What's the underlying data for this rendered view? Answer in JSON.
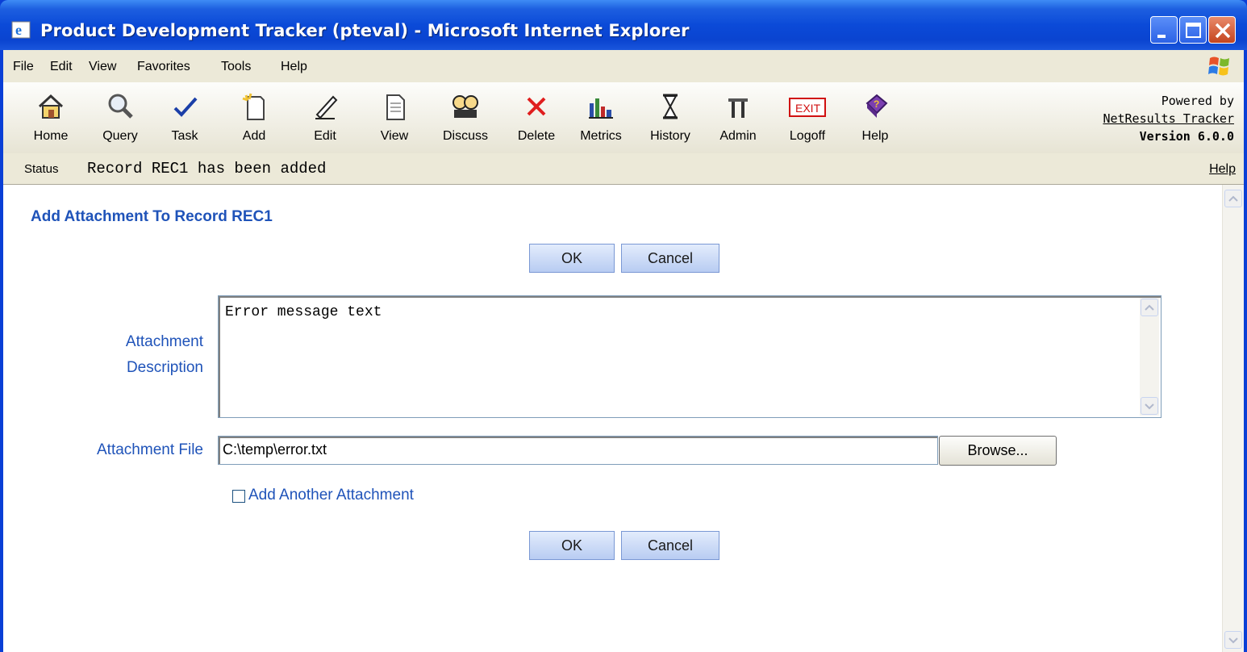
{
  "window": {
    "title": "Product Development Tracker (pteval) - Microsoft Internet Explorer"
  },
  "menu": {
    "items": [
      "File",
      "Edit",
      "View",
      "Favorites",
      "Tools",
      "Help"
    ]
  },
  "toolbar": {
    "buttons": [
      {
        "label": "Home",
        "icon": "home-icon"
      },
      {
        "label": "Query",
        "icon": "magnifier-icon"
      },
      {
        "label": "Task",
        "icon": "checkmark-icon"
      },
      {
        "label": "Add",
        "icon": "new-document-icon"
      },
      {
        "label": "Edit",
        "icon": "pencil-icon"
      },
      {
        "label": "View",
        "icon": "document-icon"
      },
      {
        "label": "Discuss",
        "icon": "people-icon"
      },
      {
        "label": "Delete",
        "icon": "red-x-icon"
      },
      {
        "label": "Metrics",
        "icon": "bar-chart-icon"
      },
      {
        "label": "History",
        "icon": "hourglass-icon"
      },
      {
        "label": "Admin",
        "icon": "tools-icon"
      },
      {
        "label": "Logoff",
        "icon": "exit-sign-icon"
      },
      {
        "label": "Help",
        "icon": "help-book-icon"
      }
    ],
    "powered_by": "Powered by",
    "product_link": "NetResults Tracker",
    "version": "Version 6.0.0"
  },
  "status": {
    "label": "Status",
    "message": "Record REC1 has been added",
    "help": "Help"
  },
  "form": {
    "heading": "Add Attachment To Record REC1",
    "ok_label": "OK",
    "cancel_label": "Cancel",
    "description_label_line1": "Attachment",
    "description_label_line2": "Description",
    "description_value": "Error message text",
    "file_label": "Attachment File",
    "file_value": "C:\\temp\\error.txt",
    "browse_label": "Browse...",
    "add_another_label": "Add Another Attachment",
    "add_another_checked": false
  },
  "colors": {
    "title_bar": "#0a44d0",
    "label_blue": "#1f53b9",
    "button_blue": "#b8ccf2",
    "chrome": "#ece9d8"
  }
}
